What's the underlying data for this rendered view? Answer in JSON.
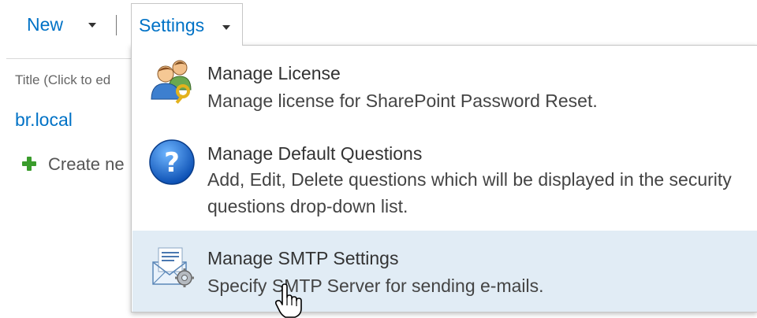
{
  "toolbar": {
    "new_label": "New",
    "settings_label": "Settings"
  },
  "list": {
    "column_title": "Title (Click to ed",
    "item_link": "br.local",
    "create_new_label": "Create ne"
  },
  "settings_menu": {
    "items": [
      {
        "title": "Manage License",
        "description": "Manage license for SharePoint Password Reset.",
        "icon": "users-key-icon"
      },
      {
        "title": "Manage Default Questions",
        "description": "Add, Edit, Delete questions which will be displayed in the security questions drop-down list.",
        "icon": "question-mark-icon"
      },
      {
        "title": "Manage SMTP Settings",
        "description": "Specify SMTP Server for sending e-mails.",
        "icon": "email-gear-icon",
        "highlighted": true
      }
    ]
  },
  "colors": {
    "link_blue": "#0072c6",
    "hover_background": "#e1ecf5",
    "plus_green": "#3a9c2c"
  }
}
